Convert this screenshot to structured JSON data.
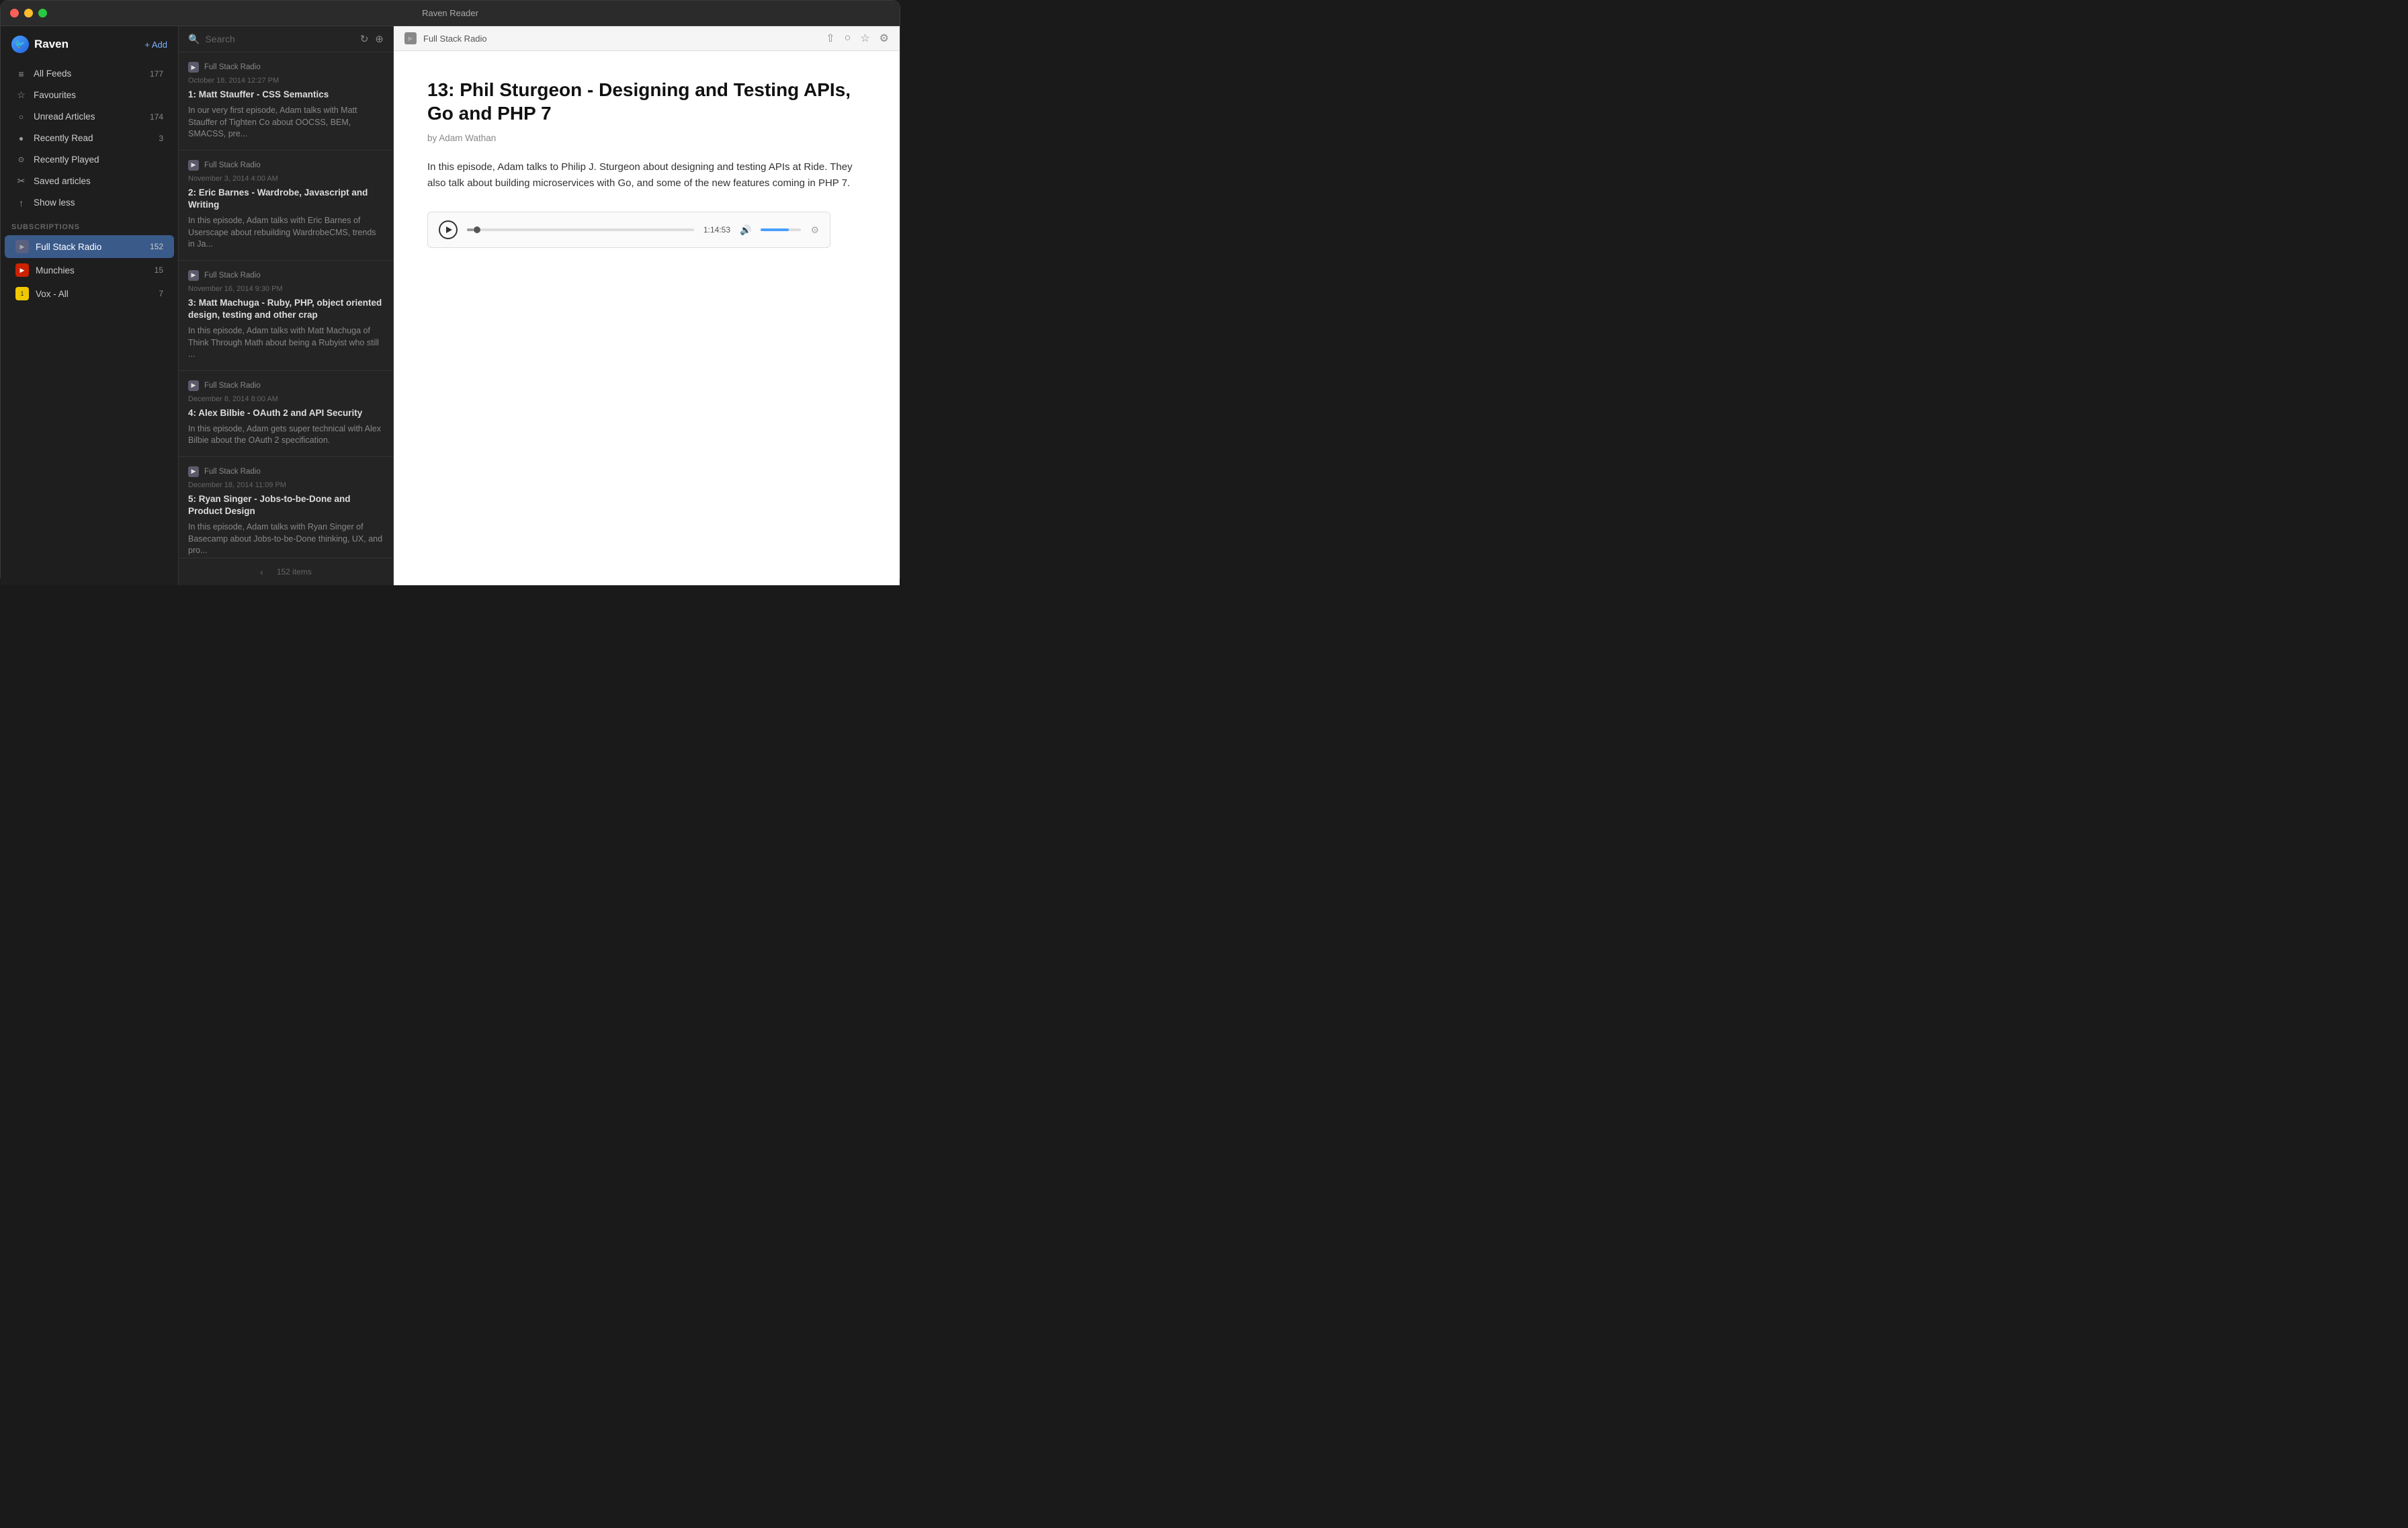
{
  "titlebar": {
    "title": "Raven Reader"
  },
  "sidebar": {
    "logo": "Raven",
    "add_label": "+ Add",
    "nav_items": [
      {
        "id": "all-feeds",
        "icon": "≡",
        "label": "All Feeds",
        "count": "177"
      },
      {
        "id": "favourites",
        "icon": "☆",
        "label": "Favourites",
        "count": ""
      },
      {
        "id": "unread-articles",
        "icon": "○",
        "label": "Unread Articles",
        "count": "174"
      },
      {
        "id": "recently-read",
        "icon": "●",
        "label": "Recently Read",
        "count": "3"
      },
      {
        "id": "recently-played",
        "icon": "⊙",
        "label": "Recently Played",
        "count": ""
      },
      {
        "id": "saved-articles",
        "icon": "⤴",
        "label": "Saved articles",
        "count": ""
      },
      {
        "id": "show-less",
        "icon": "↑",
        "label": "Show less",
        "count": ""
      }
    ],
    "section_label": "SUBSCRIPTIONS",
    "subscriptions": [
      {
        "id": "full-stack-radio",
        "label": "Full Stack Radio",
        "count": "152",
        "color": "#5a6080",
        "text_color": "#aaa",
        "active": true
      },
      {
        "id": "munchies",
        "label": "Munchies",
        "count": "15",
        "color": "#cc2200",
        "text_color": "#fff"
      },
      {
        "id": "vox-all",
        "label": "Vox - All",
        "count": "7",
        "color": "#f0c800",
        "text_color": "#222"
      }
    ]
  },
  "middle": {
    "search_placeholder": "Search",
    "feed_name": "Full Stack Radio",
    "footer_count": "152 items",
    "articles": [
      {
        "feed": "Full Stack Radio",
        "date": "October 18, 2014 12:27 PM",
        "title": "1: Matt Stauffer - CSS Semantics",
        "excerpt": "In our very first episode, Adam talks with Matt Stauffer of Tighten Co about OOCSS, BEM, SMACSS, pre..."
      },
      {
        "feed": "Full Stack Radio",
        "date": "November 3, 2014 4:00 AM",
        "title": "2: Eric Barnes - Wardrobe, Javascript and Writing",
        "excerpt": "In this episode, Adam talks with Eric Barnes of Userscape about rebuilding WardrobeCMS, trends in Ja..."
      },
      {
        "feed": "Full Stack Radio",
        "date": "November 16, 2014 9:30 PM",
        "title": "3: Matt Machuga - Ruby, PHP, object oriented design, testing and other crap",
        "excerpt": "In this episode, Adam talks with Matt Machuga of Think Through Math about being a Rubyist who still ..."
      },
      {
        "feed": "Full Stack Radio",
        "date": "December 8, 2014 8:00 AM",
        "title": "4: Alex Bilbie - OAuth 2 and API Security",
        "excerpt": "In this episode, Adam gets super technical with Alex Bilbie about the OAuth 2 specification."
      },
      {
        "feed": "Full Stack Radio",
        "date": "December 18, 2014 11:09 PM",
        "title": "5: Ryan Singer - Jobs-to-be-Done and Product Design",
        "excerpt": "In this episode, Adam talks with Ryan Singer of Basecamp about Jobs-to-be-Done thinking, UX, and pro..."
      }
    ]
  },
  "detail": {
    "feed_name": "Full Stack Radio",
    "article_title": "13: Phil Sturgeon - Designing and Testing APIs, Go and PHP 7",
    "article_author": "by Adam Wathan",
    "article_body": "In this episode, Adam talks to Philip J. Sturgeon about designing and testing APIs at Ride. They also talk about building microservices with Go, and some of the new features coming in PHP 7.",
    "player": {
      "time_display": "1:14:53",
      "progress_percent": 3,
      "volume_percent": 70
    }
  }
}
